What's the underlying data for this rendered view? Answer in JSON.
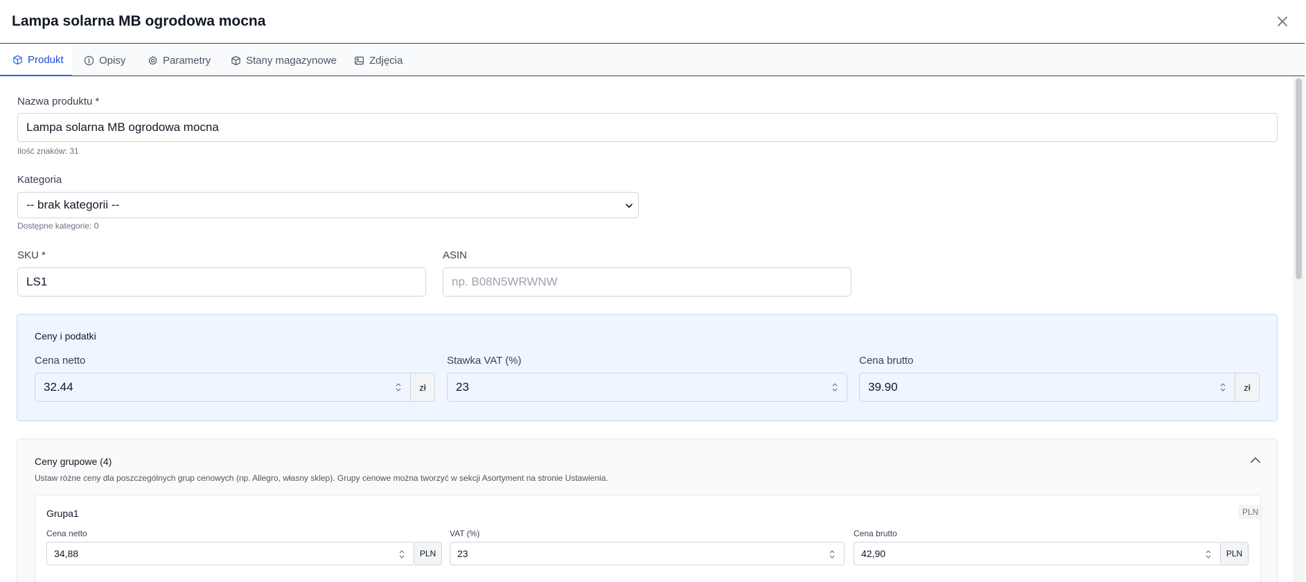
{
  "modal": {
    "title": "Lampa solarna MB ogrodowa mocna"
  },
  "tabs": [
    {
      "label": "Produkt",
      "icon": "box-icon",
      "active": true
    },
    {
      "label": "Opisy",
      "icon": "info-icon"
    },
    {
      "label": "Parametry",
      "icon": "gear-icon"
    },
    {
      "label": "Stany magazynowe",
      "icon": "box-icon"
    },
    {
      "label": "Zdjęcia",
      "icon": "image-icon"
    }
  ],
  "product": {
    "name_label": "Nazwa produktu *",
    "name_value": "Lampa solarna MB ogrodowa mocna",
    "char_count": "Ilość znaków: 31",
    "category_label": "Kategoria",
    "category_value": "-- brak kategorii --",
    "category_hint": "Dostępne kategorie: 0",
    "sku_label": "SKU *",
    "sku_value": "LS1",
    "asin_label": "ASIN",
    "asin_placeholder": "np. B08N5WRWNW"
  },
  "prices": {
    "title": "Ceny i podatki",
    "net_label": "Cena netto",
    "net_value": "32.44",
    "net_unit": "zł",
    "vat_label": "Stawka VAT (%)",
    "vat_value": "23",
    "gross_label": "Cena brutto",
    "gross_value": "39.90",
    "gross_unit": "zł"
  },
  "group_prices": {
    "title": "Ceny grupowe (4)",
    "description": "Ustaw różne ceny dla poszczególnych grup cenowych (np. Allegro, własny sklep). Grupy cenowe można tworzyć w sekcji Asortyment na stronie Ustawienia.",
    "groups": [
      {
        "name": "Grupa1",
        "currency_badge": "PLN",
        "net_label": "Cena netto",
        "net_value": "34,88",
        "net_unit": "PLN",
        "vat_label": "VAT (%)",
        "vat_value": "23",
        "gross_label": "Cena brutto",
        "gross_value": "42,90",
        "gross_unit": "PLN"
      }
    ]
  },
  "colors": {
    "accent": "#2563eb",
    "blue_section_bg": "#eff6ff"
  }
}
